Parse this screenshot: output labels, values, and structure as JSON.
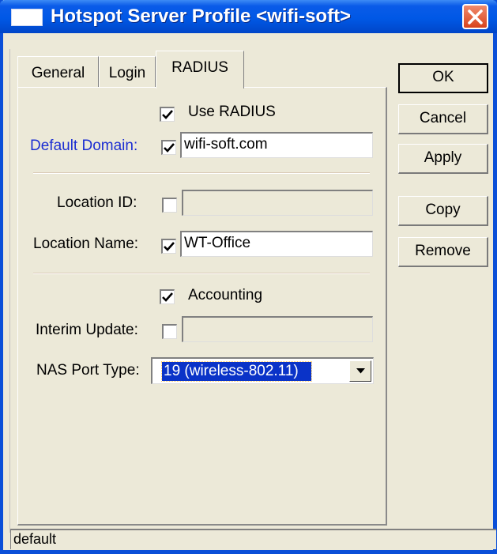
{
  "window": {
    "title": "Hotspot Server Profile <wifi-soft>",
    "icons": {
      "app": "window-icon",
      "close": "close-icon"
    },
    "accent_color": "#0a4fd8",
    "close_color": "#d8431c"
  },
  "tabs": [
    {
      "label": "General",
      "active": false
    },
    {
      "label": "Login",
      "active": false
    },
    {
      "label": "RADIUS",
      "active": true
    }
  ],
  "form": {
    "use_radius": {
      "label": "Use RADIUS",
      "checked": true
    },
    "default_domain": {
      "label": "Default Domain:",
      "checked": true,
      "value": "wifi-soft.com",
      "label_color": "#1c2ed2"
    },
    "location_id": {
      "label": "Location ID:",
      "checked": false,
      "value": ""
    },
    "location_name": {
      "label": "Location Name:",
      "checked": true,
      "value": "WT-Office"
    },
    "accounting": {
      "label": "Accounting",
      "checked": true
    },
    "interim_update": {
      "label": "Interim Update:",
      "checked": false,
      "value": ""
    },
    "nas_port_type": {
      "label": "NAS Port Type:",
      "value": "19 (wireless-802.11)",
      "icon": "chevron-down-icon"
    }
  },
  "buttons": {
    "ok": "OK",
    "cancel": "Cancel",
    "apply": "Apply",
    "copy": "Copy",
    "remove": "Remove"
  },
  "status": {
    "text": "default"
  }
}
